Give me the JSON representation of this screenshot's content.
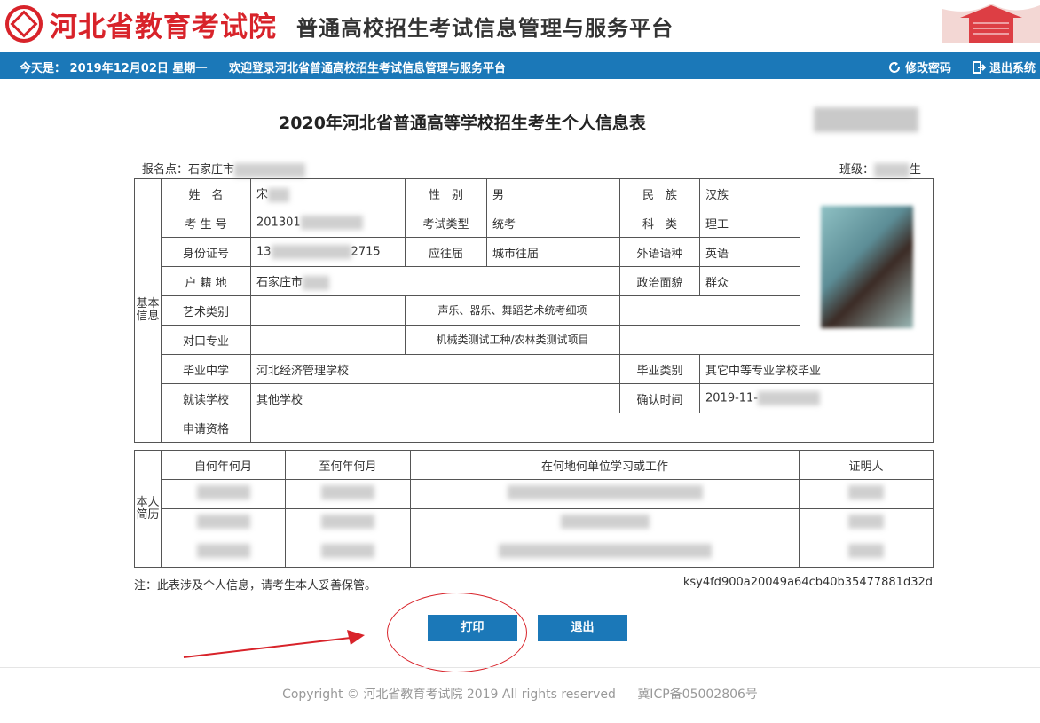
{
  "header": {
    "org_name": "河北省教育考试院",
    "platform_name": "普通高校招生考试信息管理与服务平台"
  },
  "nav": {
    "date_text": "今天是： 2019年12月02日 星期一",
    "welcome_text": "欢迎登录河北省普通高校招生考试信息管理与服务平台",
    "change_password": "修改密码",
    "logout": "退出系统"
  },
  "form": {
    "title": "2020年河北省普通高等学校招生考生个人信息表",
    "registration_point": "报名点：石家庄市",
    "class_label": "班级：",
    "class_value_suffix": "生"
  },
  "basic": {
    "section_label": "基本信息",
    "name_label": "姓　名",
    "name_value": "宋",
    "gender_label": "性　别",
    "gender_value": "男",
    "ethnicity_label": "民　族",
    "ethnicity_value": "汉族",
    "exam_no_label": "考 生 号",
    "exam_no_value": "201301",
    "exam_type_label": "考试类型",
    "exam_type_value": "统考",
    "subject_label": "科　类",
    "subject_value": "理工",
    "id_label": "身份证号",
    "id_value_prefix": "13",
    "id_value_suffix": "2715",
    "grad_status_label": "应往届",
    "grad_status_value": "城市往届",
    "lang_label": "外语语种",
    "lang_value": "英语",
    "residence_label": "户 籍 地",
    "residence_value": "石家庄市",
    "political_label": "政治面貌",
    "political_value": "群众",
    "art_label": "艺术类别",
    "art_detail_label": "声乐、器乐、舞蹈艺术统考细项",
    "vocational_label": "对口专业",
    "vocational_detail_label": "机械类测试工种/农林类测试项目",
    "school_label": "毕业中学",
    "school_value": "河北经济管理学校",
    "grad_type_label": "毕业类别",
    "grad_type_value": "其它中等专业学校毕业",
    "current_school_label": "就读学校",
    "current_school_value": "其他学校",
    "confirm_time_label": "确认时间",
    "confirm_time_value": "2019-11-",
    "qualification_label": "申请资格"
  },
  "history": {
    "section_label": "本人简历",
    "columns": [
      "自何年何月",
      "至何年何月",
      "在何地何单位学习或工作",
      "证明人"
    ]
  },
  "note": "注：此表涉及个人信息，请考生本人妥善保管。",
  "verify_code": "ksy4fd900a20049a64cb40b35477881d32d",
  "buttons": {
    "print": "打印",
    "exit": "退出"
  },
  "footer": {
    "copyright": "Copyright © 河北省教育考试院 2019 All rights reserved",
    "icp": "冀ICP备05002806号"
  },
  "colors": {
    "brand_red": "#d8232a",
    "nav_blue": "#1b78b8"
  }
}
